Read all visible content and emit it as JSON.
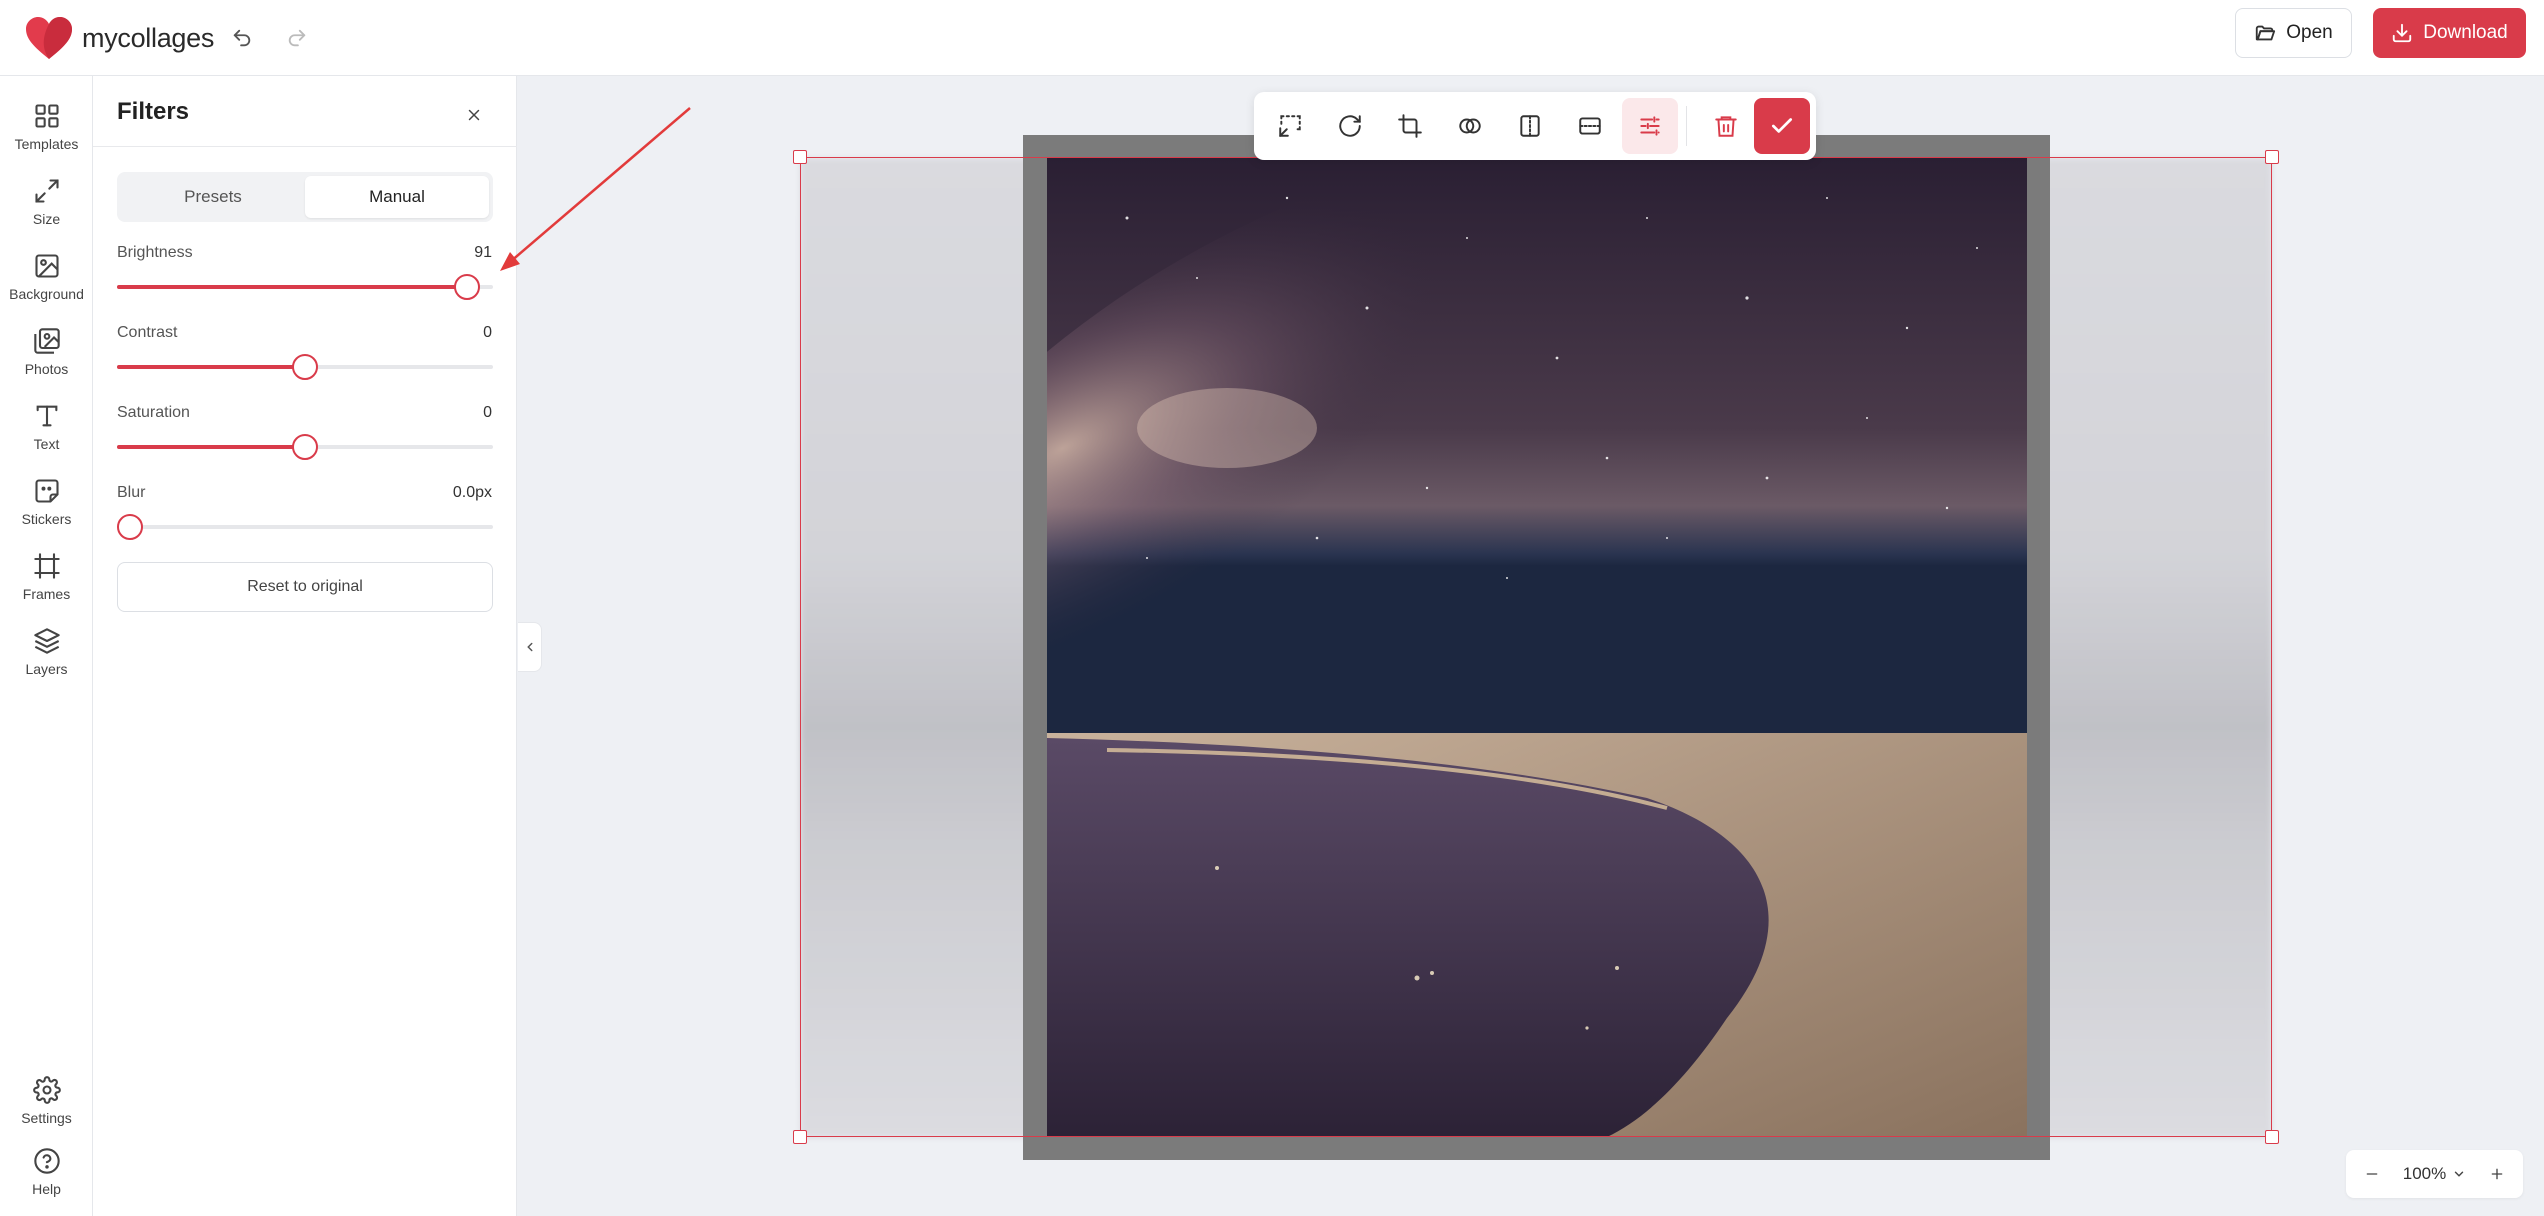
{
  "app": {
    "brand": "mycollages"
  },
  "header": {
    "open_label": "Open",
    "download_label": "Download"
  },
  "rail": {
    "items": [
      {
        "label": "Templates",
        "icon": "grid-icon"
      },
      {
        "label": "Size",
        "icon": "resize-icon"
      },
      {
        "label": "Background",
        "icon": "image-icon"
      },
      {
        "label": "Photos",
        "icon": "photos-icon"
      },
      {
        "label": "Text",
        "icon": "text-icon"
      },
      {
        "label": "Stickers",
        "icon": "sticker-icon"
      },
      {
        "label": "Frames",
        "icon": "frame-icon"
      },
      {
        "label": "Layers",
        "icon": "layers-icon"
      }
    ],
    "bottom": [
      {
        "label": "Settings",
        "icon": "gear-icon"
      },
      {
        "label": "Help",
        "icon": "help-icon"
      }
    ]
  },
  "filters": {
    "title": "Filters",
    "tabs": [
      {
        "label": "Presets"
      },
      {
        "label": "Manual",
        "active": true
      }
    ],
    "sliders": [
      {
        "label": "Brightness",
        "value_text": "91",
        "fraction": 0.93
      },
      {
        "label": "Contrast",
        "value_text": "0",
        "fraction": 0.5
      },
      {
        "label": "Saturation",
        "value_text": "0",
        "fraction": 0.5
      },
      {
        "label": "Blur",
        "value_text": "0.0px",
        "fraction": 0.0
      }
    ],
    "reset_label": "Reset to original"
  },
  "toolbar": {
    "tools": [
      "replace-image-icon",
      "rotate-icon",
      "crop-icon",
      "mask-icon",
      "flip-horizontal-icon",
      "flip-vertical-icon",
      "adjust-filters-icon",
      "delete-icon",
      "confirm-check-icon"
    ],
    "active": "adjust-filters-icon"
  },
  "zoom": {
    "value": "100%"
  },
  "colors": {
    "accent": "#d93b4a",
    "panel": "#ffffff",
    "canvas_bg": "#eef0f4"
  }
}
